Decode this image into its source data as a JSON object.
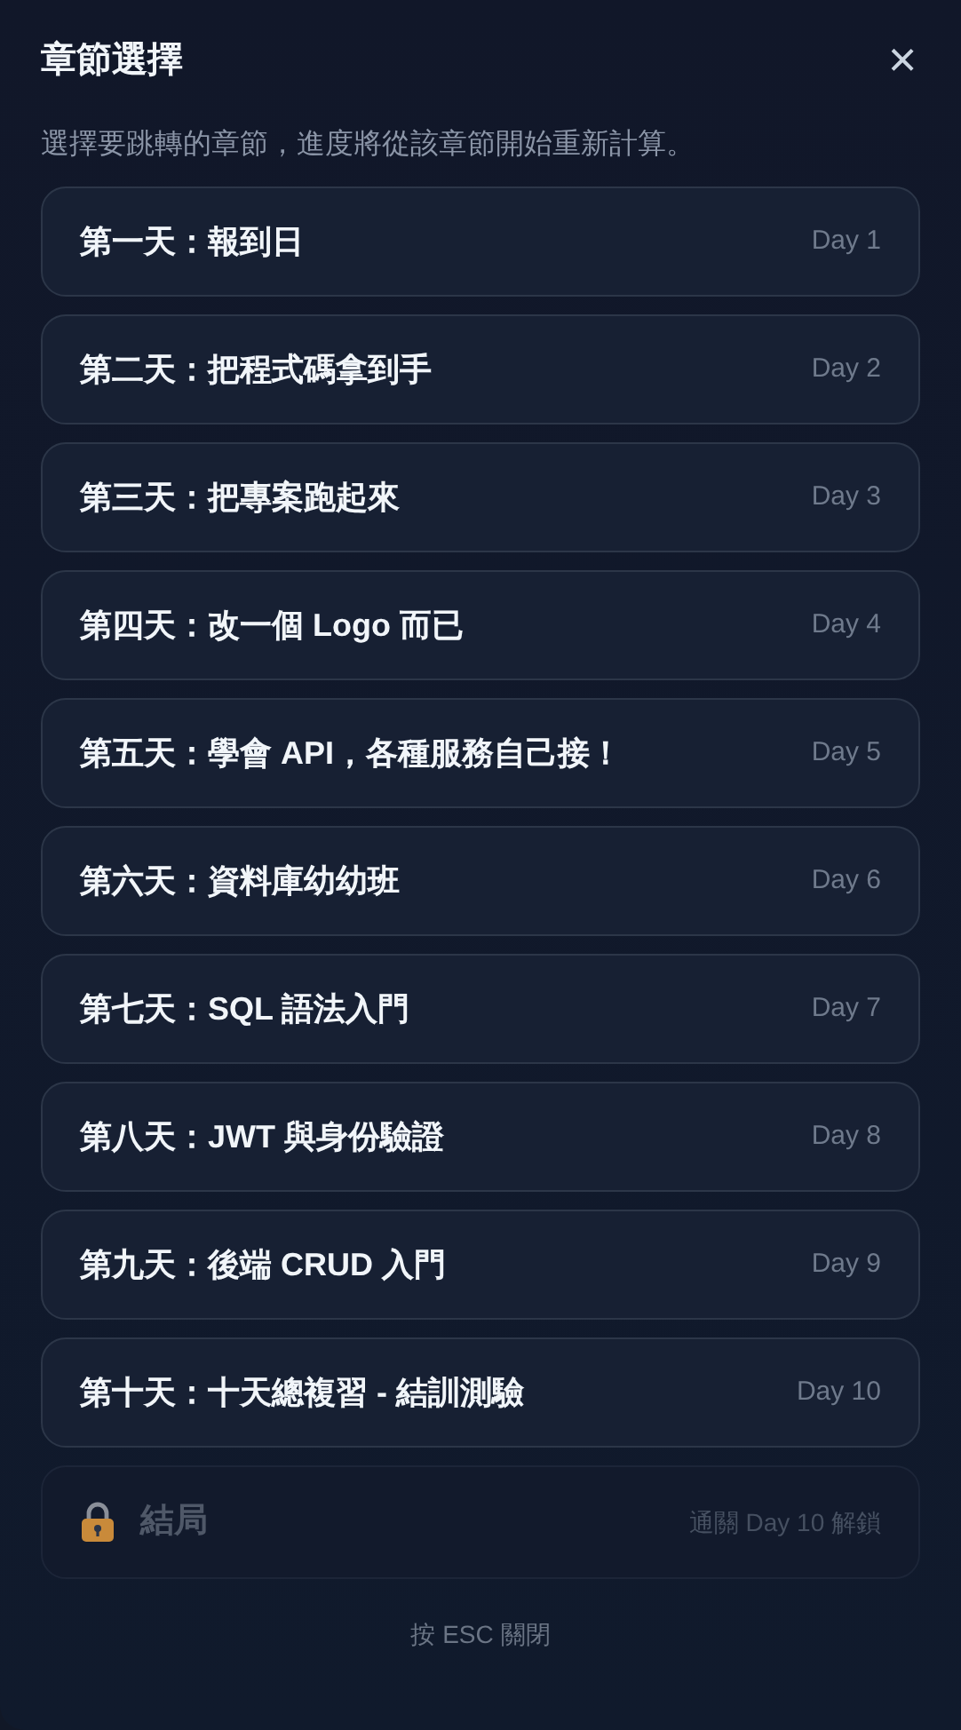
{
  "dialog": {
    "title": "章節選擇",
    "close": "×",
    "description": "選擇要跳轉的章節，進度將從該章節開始重新計算。"
  },
  "chapters": [
    {
      "title": "第一天：報到日",
      "day": "Day 1",
      "locked": false
    },
    {
      "title": "第二天：把程式碼拿到手",
      "day": "Day 2",
      "locked": false
    },
    {
      "title": "第三天：把專案跑起來",
      "day": "Day 3",
      "locked": false
    },
    {
      "title": "第四天：改一個 Logo 而已",
      "day": "Day 4",
      "locked": false
    },
    {
      "title": "第五天：學會 API，各種服務自己接！",
      "day": "Day 5",
      "locked": false
    },
    {
      "title": "第六天：資料庫幼幼班",
      "day": "Day 6",
      "locked": false
    },
    {
      "title": "第七天：SQL 語法入門",
      "day": "Day 7",
      "locked": false
    },
    {
      "title": "第八天：JWT 與身份驗證",
      "day": "Day 8",
      "locked": false
    },
    {
      "title": "第九天：後端 CRUD 入門",
      "day": "Day 9",
      "locked": false
    },
    {
      "title": "第十天：十天總複習 - 結訓測驗",
      "day": "Day 10",
      "locked": false
    },
    {
      "title": "結局",
      "day": "通關 Day 10 解鎖",
      "locked": true
    }
  ],
  "footer": "按 ESC 關閉"
}
